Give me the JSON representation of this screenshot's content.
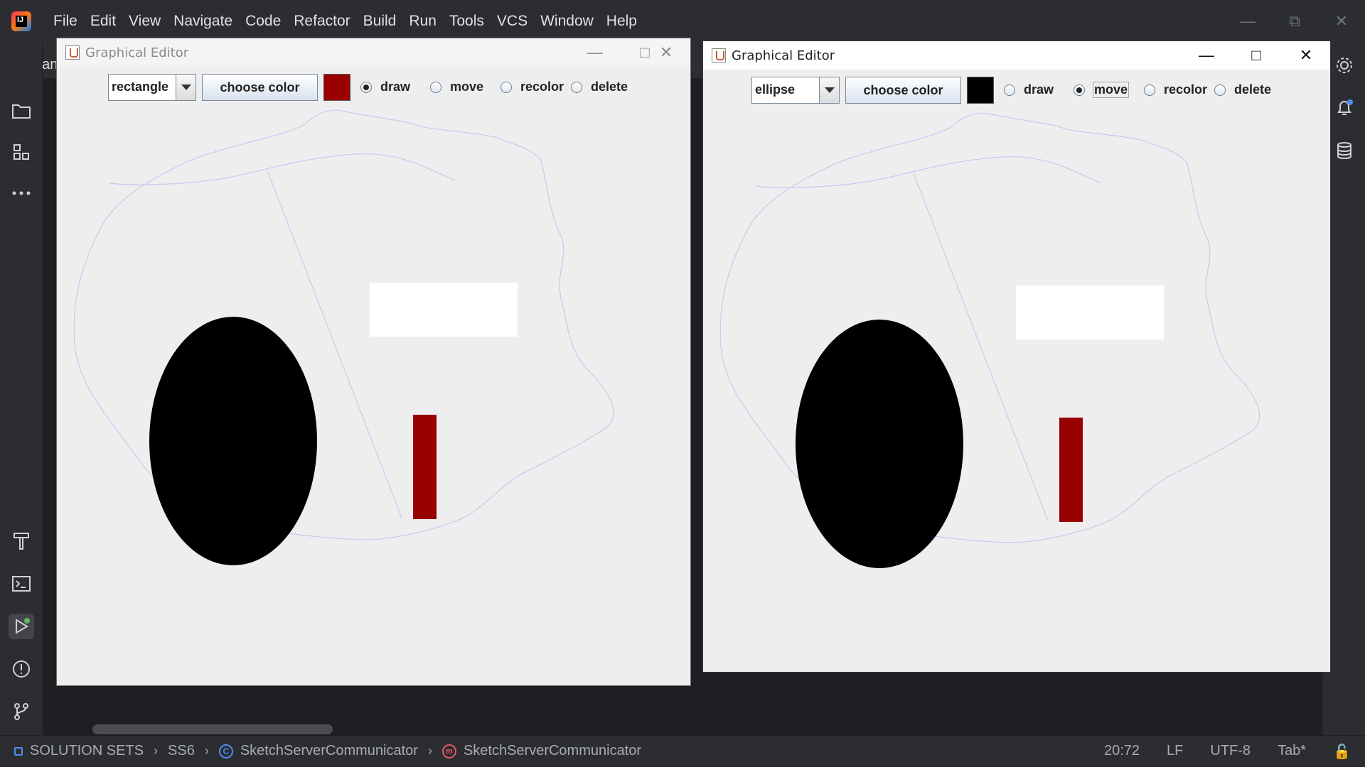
{
  "ide": {
    "menu": [
      "File",
      "Edit",
      "View",
      "Navigate",
      "Code",
      "Refactor",
      "Build",
      "Run",
      "Tools",
      "VCS",
      "Window",
      "Help"
    ],
    "tab_partial": "Rectan",
    "status": {
      "breadcrumbs": [
        "SOLUTION SETS",
        "SS6",
        "SketchServerCommunicator",
        "SketchServerCommunicator"
      ],
      "position": "20:72",
      "line_ending": "LF",
      "encoding": "UTF-8",
      "indent": "Tab*"
    }
  },
  "editors": [
    {
      "title": "Graphical Editor",
      "shape_type": "rectangle",
      "choose_color_label": "choose color",
      "current_color": "#990000",
      "modes": [
        "draw",
        "move",
        "recolor",
        "delete"
      ],
      "selected_mode": "draw"
    },
    {
      "title": "Graphical Editor",
      "shape_type": "ellipse",
      "choose_color_label": "choose color",
      "current_color": "#000000",
      "modes": [
        "draw",
        "move",
        "recolor",
        "delete"
      ],
      "selected_mode": "move"
    }
  ],
  "sketch": {
    "shapes": [
      {
        "type": "freehand",
        "color": "#c8c8f2"
      },
      {
        "type": "segment",
        "color": "#c8c8f2"
      },
      {
        "type": "rectangle",
        "color": "#ffffff"
      },
      {
        "type": "ellipse",
        "color": "#000000"
      },
      {
        "type": "rectangle",
        "color": "#990000"
      }
    ]
  }
}
